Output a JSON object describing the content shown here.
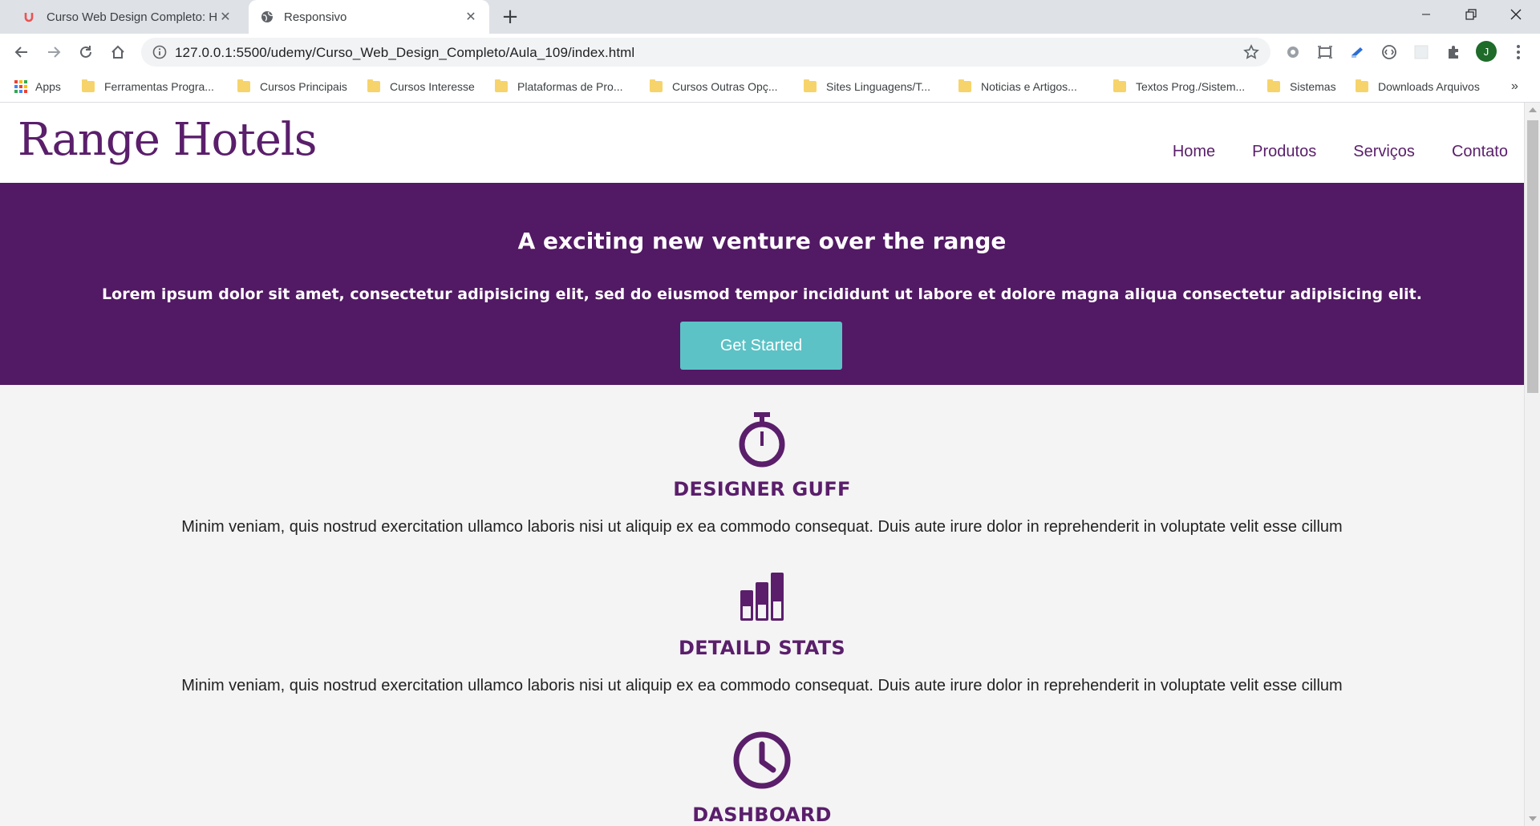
{
  "browser": {
    "tabs": [
      {
        "title": "Curso Web Design Completo: HT",
        "active": false,
        "favicon": "udemy-icon"
      },
      {
        "title": "Responsivo",
        "active": true,
        "favicon": "globe-icon"
      }
    ],
    "url": "127.0.0.1:5500/udemy/Curso_Web_Design_Completo/Aula_109/index.html",
    "avatar_letter": "J",
    "bookmarks": [
      "Apps",
      "Ferramentas Progra...",
      "Cursos Principais",
      "Cursos Interesse",
      "Plataformas de Pro...",
      "Cursos Outras Opç...",
      "Sites Linguagens/T...",
      "Noticias e Artigos...",
      "Textos Prog./Sistem...",
      "Sistemas",
      "Downloads Arquivos"
    ],
    "bookmarks_overflow": "»"
  },
  "site": {
    "logo": "Range Hotels",
    "nav": [
      "Home",
      "Produtos",
      "Serviços",
      "Contato"
    ],
    "hero": {
      "title": "A exciting new venture over the range",
      "text": "Lorem ipsum dolor sit amet, consectetur adipisicing elit, sed do eiusmod tempor incididunt ut labore et dolore magna aliqua consectetur adipisicing elit.",
      "button": "Get Started"
    },
    "features": [
      {
        "icon": "stopwatch-icon",
        "title": "DESIGNER GUFF",
        "text": "Minim veniam, quis nostrud exercitation ullamco laboris nisi ut aliquip ex ea commodo consequat. Duis aute irure dolor in reprehenderit in voluptate velit esse cillum"
      },
      {
        "icon": "bar-stats-icon",
        "title": "DETAILD STATS",
        "text": "Minim veniam, quis nostrud exercitation ullamco laboris nisi ut aliquip ex ea commodo consequat. Duis aute irure dolor in reprehenderit in voluptate velit esse cillum"
      },
      {
        "icon": "clock-icon",
        "title": "DASHBOARD",
        "text": ""
      }
    ],
    "colors": {
      "brand": "#5a1e6b",
      "hero_bg": "#521964",
      "button": "#5cc2c6"
    }
  }
}
